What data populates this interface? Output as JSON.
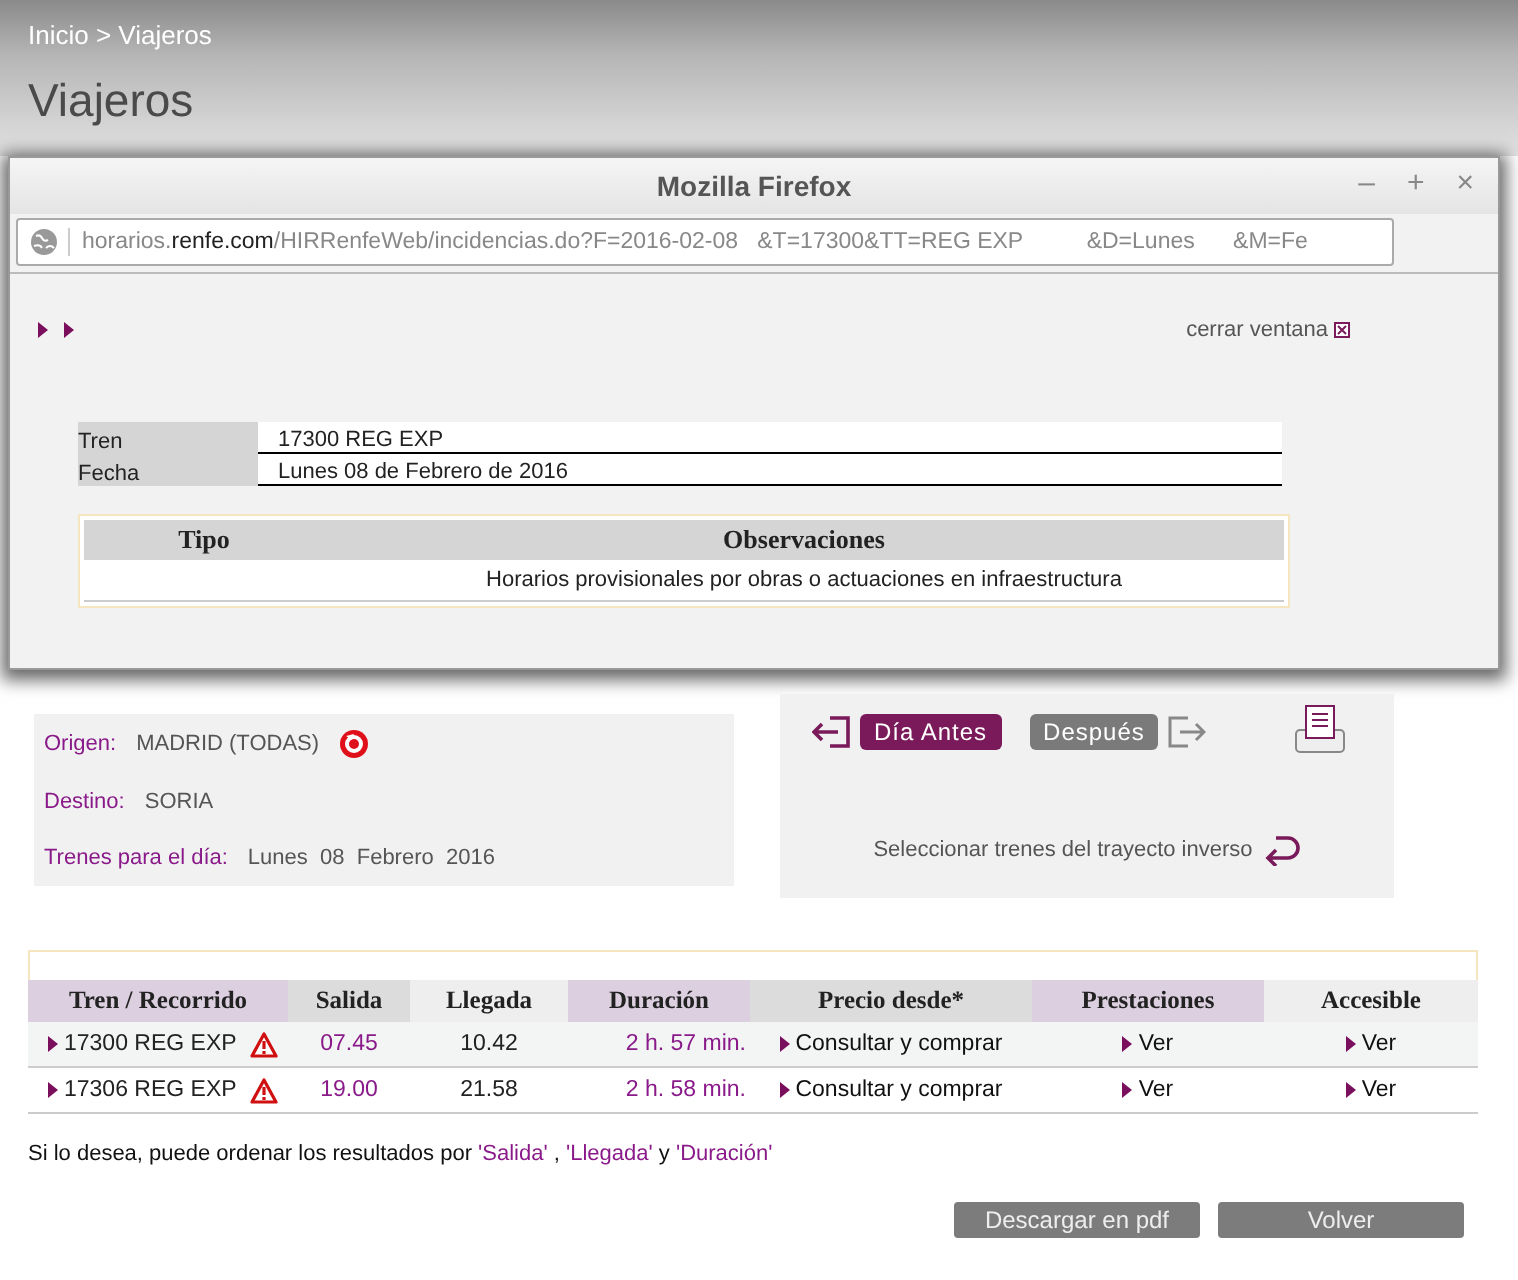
{
  "breadcrumb": "Inicio > Viajeros",
  "page_title": "Viajeros",
  "popup": {
    "title": "Mozilla Firefox",
    "window_buttons": [
      "–",
      "+",
      "×"
    ],
    "url": {
      "prefix": "horarios.",
      "domain": "renfe.com",
      "path": "/HIRRenfeWeb/incidencias.do?F=2016-02-08   &T=17300&TT=REG EXP          &D=Lunes      &M=Fe"
    },
    "close_link": "cerrar ventana",
    "details": [
      {
        "label": "Tren",
        "value": "17300 REG EXP"
      },
      {
        "label": "Fecha",
        "value": "Lunes 08 de Febrero de 2016"
      }
    ],
    "incidents": {
      "columns": [
        "Tipo",
        "Observaciones"
      ],
      "rows": [
        [
          "",
          "Horarios provisionales por obras o actuaciones en infraestructura"
        ]
      ]
    }
  },
  "search": {
    "origin_label": "Origen:",
    "origin": "MADRID (TODAS)",
    "destination_label": "Destino:",
    "destination": "SORIA",
    "day_label": "Trenes para el día:",
    "day": "Lunes  08  Febrero  2016"
  },
  "nav": {
    "prev": "Día Antes",
    "next": "Después",
    "reverse": "Seleccionar trenes del trayecto inverso"
  },
  "table": {
    "columns": [
      "Tren / Recorrido",
      "Salida",
      "Llegada",
      "Duración",
      "Precio desde*",
      "Prestaciones",
      "Accesible"
    ],
    "rows": [
      {
        "train": "17300 REG EXP",
        "warning": true,
        "departure": "07.45",
        "arrival": "10.42",
        "duration": "2 h. 57 min.",
        "price": "Consultar y comprar",
        "services": "Ver",
        "accessible": "Ver"
      },
      {
        "train": "17306 REG EXP",
        "warning": true,
        "departure": "19.00",
        "arrival": "21.58",
        "duration": "2 h. 58 min.",
        "price": "Consultar y comprar",
        "services": "Ver",
        "accessible": "Ver"
      }
    ]
  },
  "sort_note": [
    {
      "kind": "text",
      "text": "Si lo desea, puede ordenar los resultados por "
    },
    {
      "kind": "link",
      "text": "'Salida'"
    },
    {
      "kind": "text",
      "text": " , "
    },
    {
      "kind": "link",
      "text": "'Llegada'"
    },
    {
      "kind": "text",
      "text": " y "
    },
    {
      "kind": "link",
      "text": "'Duración'"
    }
  ],
  "buttons": [
    "Descargar en pdf",
    "Volver"
  ]
}
